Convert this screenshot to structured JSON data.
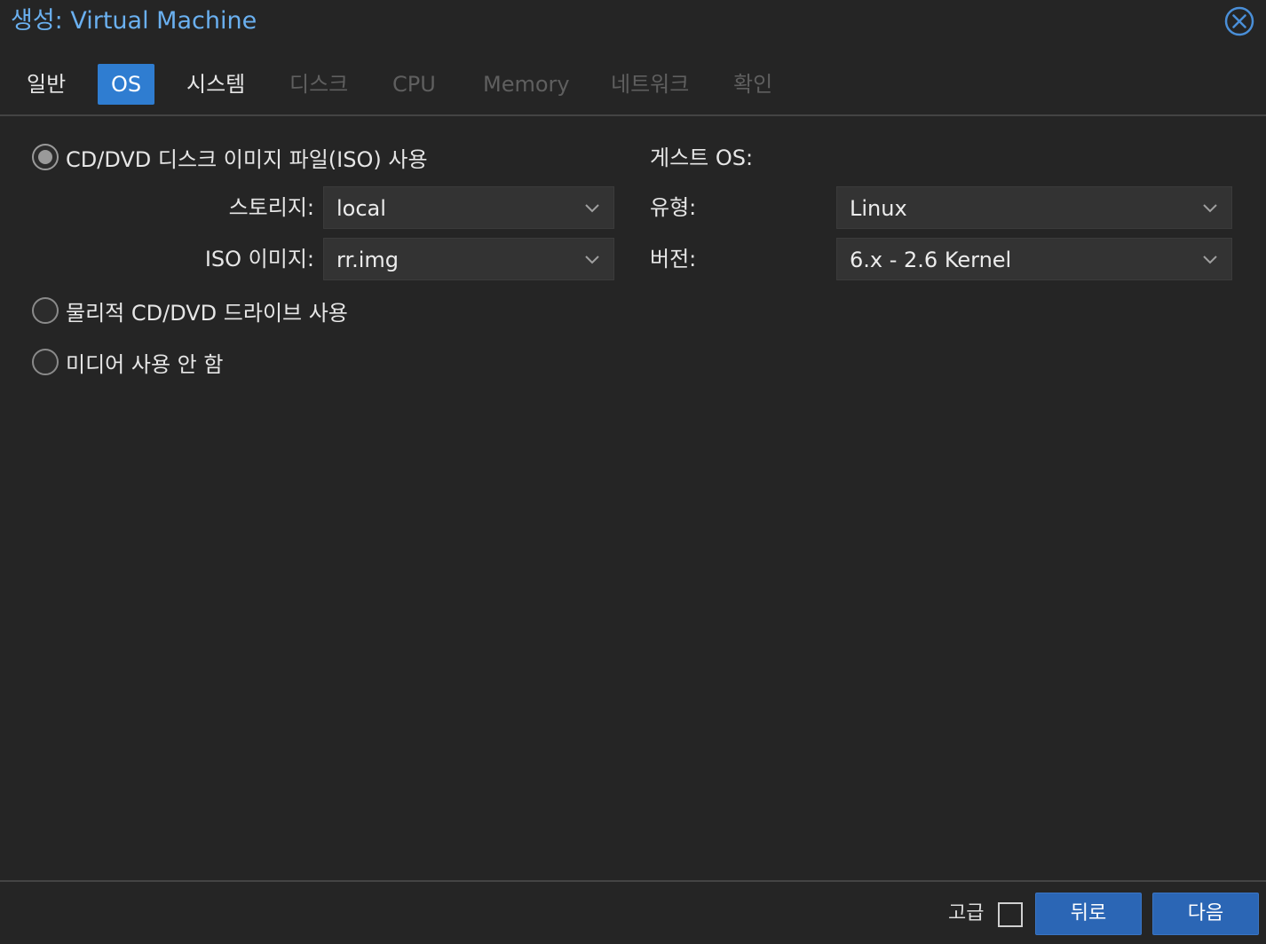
{
  "header": {
    "title": "생성: Virtual Machine",
    "close_icon": "close-circle-icon"
  },
  "tabs": [
    {
      "label": "일반",
      "state": "enabled"
    },
    {
      "label": "OS",
      "state": "active"
    },
    {
      "label": "시스템",
      "state": "enabled"
    },
    {
      "label": "디스크",
      "state": "disabled"
    },
    {
      "label": "CPU",
      "state": "disabled"
    },
    {
      "label": "Memory",
      "state": "disabled"
    },
    {
      "label": "네트워크",
      "state": "disabled"
    },
    {
      "label": "확인",
      "state": "disabled"
    }
  ],
  "media": {
    "options": [
      {
        "label": "CD/DVD 디스크 이미지 파일(ISO) 사용",
        "checked": true
      },
      {
        "label": "물리적 CD/DVD 드라이브 사용",
        "checked": false
      },
      {
        "label": "미디어 사용 안 함",
        "checked": false
      }
    ],
    "storage": {
      "label": "스토리지:",
      "value": "local"
    },
    "iso_image": {
      "label": "ISO 이미지:",
      "value": "rr.img"
    }
  },
  "guest_os": {
    "title": "게스트 OS:",
    "type": {
      "label": "유형:",
      "value": "Linux"
    },
    "version": {
      "label": "버전:",
      "value": "6.x - 2.6 Kernel"
    }
  },
  "footer": {
    "advanced_label": "고급",
    "advanced_checked": false,
    "back_label": "뒤로",
    "next_label": "다음"
  },
  "colors": {
    "accent": "#2f7dd1",
    "title": "#6ab0f0",
    "background": "#252525"
  }
}
